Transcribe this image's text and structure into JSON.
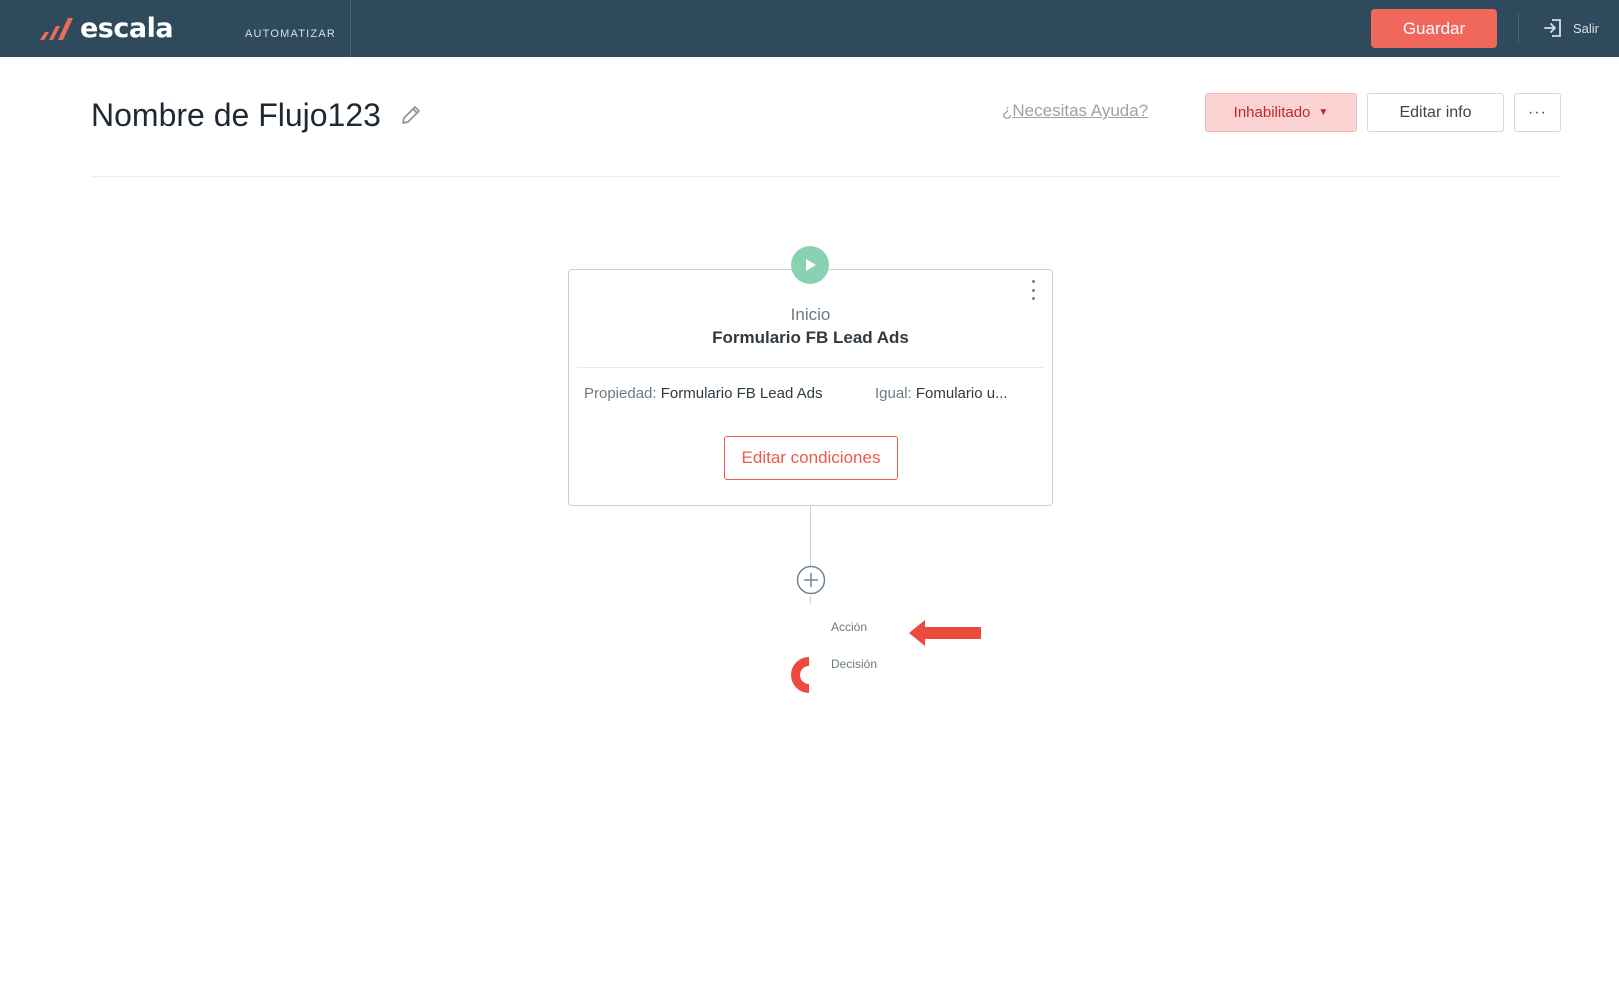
{
  "topbar": {
    "logo_text": "escala",
    "section_label": "AUTOMATIZAR",
    "save_label": "Guardar",
    "exit_label": "Salir",
    "colors": {
      "background": "#2e4a5c",
      "accent": "#f0685c"
    }
  },
  "header": {
    "title": "Nombre de Flujo123",
    "help_link": "¿Necesitas Ayuda?",
    "status_label": "Inhabilitado",
    "edit_info_label": "Editar info",
    "more_label": "···"
  },
  "trigger_card": {
    "kicker": "Inicio",
    "title": "Formulario FB Lead Ads",
    "conditions": [
      {
        "key": "Propiedad:",
        "value": "Formulario FB Lead Ads"
      },
      {
        "key": "Igual:",
        "value": "Fomulario u..."
      }
    ],
    "edit_label": "Editar condiciones",
    "colors": {
      "play": "#8ad1b4",
      "border": "#c5d3da"
    }
  },
  "add_menu": {
    "items": [
      {
        "label": "Acción"
      },
      {
        "label": "Decisión"
      }
    ],
    "arrow_color": "#ec4a3c"
  }
}
